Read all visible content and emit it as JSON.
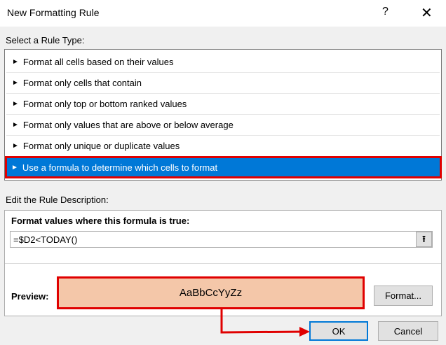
{
  "title": "New Formatting Rule",
  "help_label": "?",
  "close_label": "✕",
  "select_label": "Select a Rule Type:",
  "rule_types": [
    {
      "label": "Format all cells based on their values"
    },
    {
      "label": "Format only cells that contain"
    },
    {
      "label": "Format only top or bottom ranked values"
    },
    {
      "label": "Format only values that are above or below average"
    },
    {
      "label": "Format only unique or duplicate values"
    },
    {
      "label": "Use a formula to determine which cells to format",
      "selected": true
    }
  ],
  "arrow_glyph": "►",
  "edit_label": "Edit the Rule Description:",
  "formula_label": "Format values where this formula is true:",
  "formula_value": "=$D2<TODAY()",
  "ref_button": "⭱",
  "preview_label": "Preview:",
  "preview_text": "AaBbCcYyZz",
  "preview_color": "#f4c7a9",
  "format_button": "Format...",
  "ok_button": "OK",
  "cancel_button": "Cancel"
}
